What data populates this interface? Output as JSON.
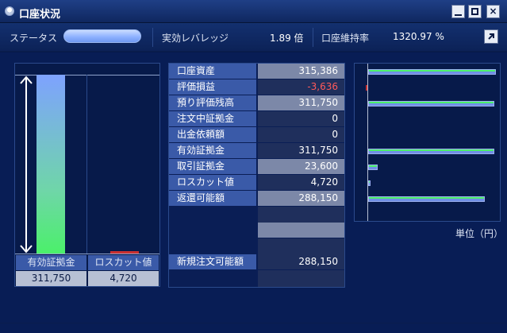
{
  "window": {
    "title": "口座状況",
    "buttons": {
      "minimize": "minimize",
      "maximize": "maximize",
      "close": "×"
    }
  },
  "status": {
    "status_label": "ステータス",
    "leverage_label": "実効レバレッジ",
    "leverage_value": "1.89 倍",
    "maintenance_label": "口座維持率",
    "maintenance_value": "1320.97 %"
  },
  "left_panel": {
    "effective_margin_label": "有効証拠金",
    "effective_margin_value": "311,750",
    "losscut_label": "ロスカット値",
    "losscut_value": "4,720",
    "effective_margin_amount": 311750,
    "losscut_amount": 4720
  },
  "table": {
    "rows": [
      {
        "label": "口座資産",
        "value": "315,386",
        "amount": 315386,
        "negative": false
      },
      {
        "label": "評価損益",
        "value": "-3,636",
        "amount": -3636,
        "negative": true
      },
      {
        "label": "預り評価残高",
        "value": "311,750",
        "amount": 311750,
        "negative": false
      },
      {
        "label": "注文中証拠金",
        "value": "0",
        "amount": 0,
        "negative": false
      },
      {
        "label": "出金依頼額",
        "value": "0",
        "amount": 0,
        "negative": false
      },
      {
        "label": "有効証拠金",
        "value": "311,750",
        "amount": 311750,
        "negative": false
      },
      {
        "label": "取引証拠金",
        "value": "23,600",
        "amount": 23600,
        "negative": false
      },
      {
        "label": "ロスカット値",
        "value": "4,720",
        "amount": 4720,
        "negative": false
      },
      {
        "label": "返還可能額",
        "value": "288,150",
        "amount": 288150,
        "negative": false
      }
    ],
    "new_order_label": "新規注文可能額",
    "new_order_value": "288,150"
  },
  "right_panel": {
    "unit_label": "単位（円）"
  },
  "colors": {
    "background": "#071a4a",
    "accent": "#3a5aa8",
    "positive_bar": "#6f8fe6",
    "negative": "#ff5a5a",
    "green": "#4bf06a"
  }
}
